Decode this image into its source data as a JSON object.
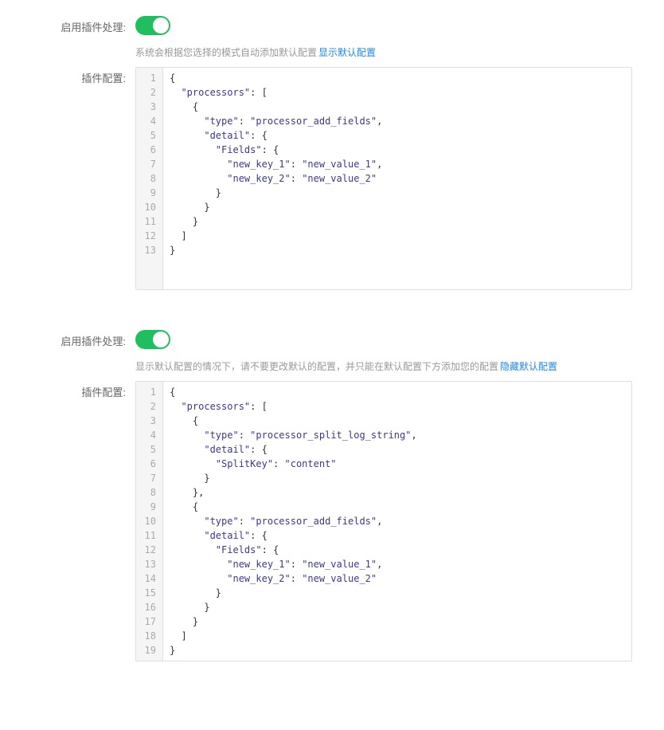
{
  "section1": {
    "toggleLabel": "启用插件处理:",
    "hintText": "系统会根据您选择的模式自动添加默认配置",
    "hintLink": "显示默认配置",
    "configLabel": "插件配置:",
    "code": {
      "lines": [
        {
          "indent": 0,
          "tokens": [
            {
              "t": "punc",
              "v": "{"
            }
          ]
        },
        {
          "indent": 1,
          "tokens": [
            {
              "t": "key",
              "v": "\"processors\""
            },
            {
              "t": "punc",
              "v": ": ["
            }
          ]
        },
        {
          "indent": 2,
          "tokens": [
            {
              "t": "punc",
              "v": "{"
            }
          ]
        },
        {
          "indent": 3,
          "tokens": [
            {
              "t": "key",
              "v": "\"type\""
            },
            {
              "t": "punc",
              "v": ": "
            },
            {
              "t": "str",
              "v": "\"processor_add_fields\""
            },
            {
              "t": "punc",
              "v": ","
            }
          ]
        },
        {
          "indent": 3,
          "tokens": [
            {
              "t": "key",
              "v": "\"detail\""
            },
            {
              "t": "punc",
              "v": ": {"
            }
          ]
        },
        {
          "indent": 4,
          "tokens": [
            {
              "t": "key",
              "v": "\"Fields\""
            },
            {
              "t": "punc",
              "v": ": {"
            }
          ]
        },
        {
          "indent": 5,
          "tokens": [
            {
              "t": "key",
              "v": "\"new_key_1\""
            },
            {
              "t": "punc",
              "v": ": "
            },
            {
              "t": "str",
              "v": "\"new_value_1\""
            },
            {
              "t": "punc",
              "v": ","
            }
          ]
        },
        {
          "indent": 5,
          "tokens": [
            {
              "t": "key",
              "v": "\"new_key_2\""
            },
            {
              "t": "punc",
              "v": ": "
            },
            {
              "t": "str",
              "v": "\"new_value_2\""
            }
          ]
        },
        {
          "indent": 4,
          "tokens": [
            {
              "t": "punc",
              "v": "}"
            }
          ]
        },
        {
          "indent": 3,
          "tokens": [
            {
              "t": "punc",
              "v": "}"
            }
          ]
        },
        {
          "indent": 2,
          "tokens": [
            {
              "t": "punc",
              "v": "}"
            }
          ]
        },
        {
          "indent": 1,
          "tokens": [
            {
              "t": "punc",
              "v": "]"
            }
          ]
        },
        {
          "indent": 0,
          "tokens": [
            {
              "t": "punc",
              "v": "}"
            }
          ]
        }
      ]
    }
  },
  "section2": {
    "toggleLabel": "启用插件处理:",
    "hintText": "显示默认配置的情况下，请不要更改默认的配置，并只能在默认配置下方添加您的配置",
    "hintLink": "隐藏默认配置",
    "configLabel": "插件配置:",
    "code": {
      "lines": [
        {
          "indent": 0,
          "tokens": [
            {
              "t": "punc",
              "v": "{"
            }
          ]
        },
        {
          "indent": 1,
          "tokens": [
            {
              "t": "key",
              "v": "\"processors\""
            },
            {
              "t": "punc",
              "v": ": ["
            }
          ]
        },
        {
          "indent": 2,
          "tokens": [
            {
              "t": "punc",
              "v": "{"
            }
          ]
        },
        {
          "indent": 3,
          "tokens": [
            {
              "t": "key",
              "v": "\"type\""
            },
            {
              "t": "punc",
              "v": ": "
            },
            {
              "t": "str",
              "v": "\"processor_split_log_string\""
            },
            {
              "t": "punc",
              "v": ","
            }
          ]
        },
        {
          "indent": 3,
          "tokens": [
            {
              "t": "key",
              "v": "\"detail\""
            },
            {
              "t": "punc",
              "v": ": {"
            }
          ]
        },
        {
          "indent": 4,
          "tokens": [
            {
              "t": "key",
              "v": "\"SplitKey\""
            },
            {
              "t": "punc",
              "v": ": "
            },
            {
              "t": "str",
              "v": "\"content\""
            }
          ]
        },
        {
          "indent": 3,
          "tokens": [
            {
              "t": "punc",
              "v": "}"
            }
          ]
        },
        {
          "indent": 2,
          "tokens": [
            {
              "t": "punc",
              "v": "},"
            }
          ]
        },
        {
          "indent": 2,
          "tokens": [
            {
              "t": "punc",
              "v": "{"
            }
          ]
        },
        {
          "indent": 3,
          "tokens": [
            {
              "t": "key",
              "v": "\"type\""
            },
            {
              "t": "punc",
              "v": ": "
            },
            {
              "t": "str",
              "v": "\"processor_add_fields\""
            },
            {
              "t": "punc",
              "v": ","
            }
          ]
        },
        {
          "indent": 3,
          "tokens": [
            {
              "t": "key",
              "v": "\"detail\""
            },
            {
              "t": "punc",
              "v": ": {"
            }
          ]
        },
        {
          "indent": 4,
          "tokens": [
            {
              "t": "key",
              "v": "\"Fields\""
            },
            {
              "t": "punc",
              "v": ": {"
            }
          ]
        },
        {
          "indent": 5,
          "tokens": [
            {
              "t": "key",
              "v": "\"new_key_1\""
            },
            {
              "t": "punc",
              "v": ": "
            },
            {
              "t": "str",
              "v": "\"new_value_1\""
            },
            {
              "t": "punc",
              "v": ","
            }
          ]
        },
        {
          "indent": 5,
          "tokens": [
            {
              "t": "key",
              "v": "\"new_key_2\""
            },
            {
              "t": "punc",
              "v": ": "
            },
            {
              "t": "str",
              "v": "\"new_value_2\""
            }
          ]
        },
        {
          "indent": 4,
          "tokens": [
            {
              "t": "punc",
              "v": "}"
            }
          ]
        },
        {
          "indent": 3,
          "tokens": [
            {
              "t": "punc",
              "v": "}"
            }
          ]
        },
        {
          "indent": 2,
          "tokens": [
            {
              "t": "punc",
              "v": "}"
            }
          ]
        },
        {
          "indent": 1,
          "tokens": [
            {
              "t": "punc",
              "v": "]"
            }
          ]
        },
        {
          "indent": 0,
          "tokens": [
            {
              "t": "punc",
              "v": "}"
            }
          ]
        }
      ]
    }
  }
}
